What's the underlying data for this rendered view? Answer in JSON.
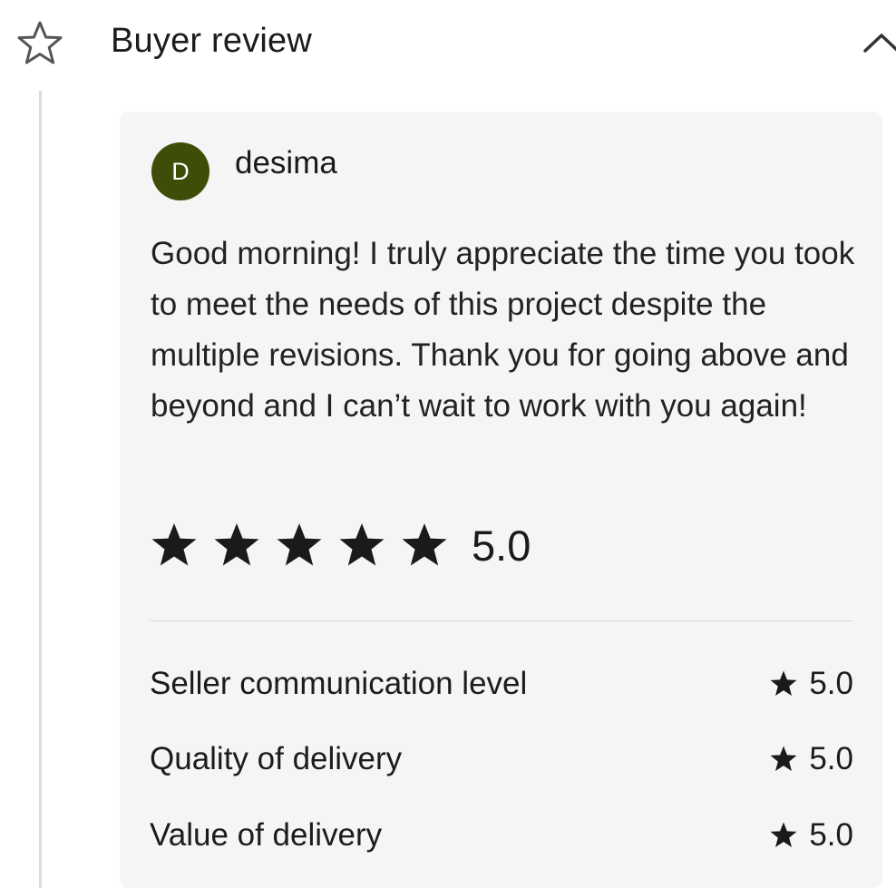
{
  "header": {
    "title": "Buyer review",
    "left_icon": "star-outline-icon",
    "right_icon": "chevron-up-icon"
  },
  "review": {
    "avatar_initial": "D",
    "avatar_color": "#3e4d08",
    "reviewer_name": "desima",
    "text": "Good morning! I truly appreciate the time you took to meet the needs of this project despite the multiple revisions. Thank you for going above and beyond and I can’t wait to work with you again!",
    "overall_stars": 5,
    "overall_score": "5.0",
    "breakdown": [
      {
        "label": "Seller communication level",
        "score": "5.0"
      },
      {
        "label": "Quality of delivery",
        "score": "5.0"
      },
      {
        "label": "Value of delivery",
        "score": "5.0"
      }
    ]
  }
}
